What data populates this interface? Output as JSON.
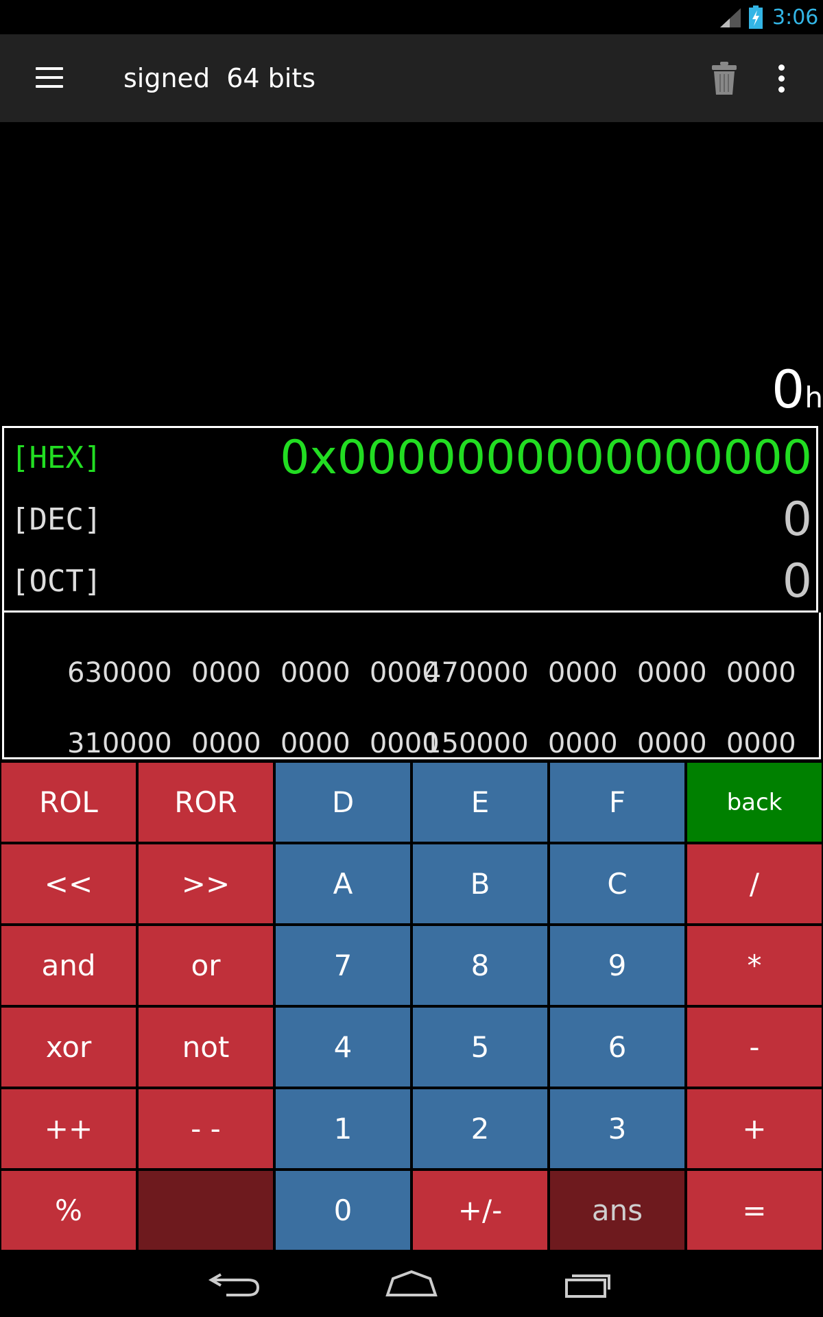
{
  "status_bar": {
    "time": "3:06",
    "icons": [
      "signal-icon",
      "battery-charging-icon"
    ]
  },
  "action_bar": {
    "title": "signed  64 bits",
    "icons": [
      "menu-icon",
      "trash-icon",
      "overflow-menu-icon"
    ]
  },
  "display": {
    "result": "0",
    "result_suffix": "h",
    "bases": [
      {
        "label": "[HEX]",
        "value": "0x0000000000000000",
        "active": true
      },
      {
        "label": "[DEC]",
        "value": "0",
        "active": false
      },
      {
        "label": "[OCT]",
        "value": "0",
        "active": false
      }
    ],
    "bits": [
      {
        "groups": [
          "0000",
          "0000",
          "0000",
          "0000",
          "0000",
          "0000",
          "0000",
          "0000"
        ],
        "index_left": "63",
        "index_mid": "47"
      },
      {
        "groups": [
          "0000",
          "0000",
          "0000",
          "0000",
          "0000",
          "0000",
          "0000",
          "0000"
        ],
        "index_left": "31",
        "index_mid": "15"
      }
    ]
  },
  "keypad": {
    "rows": [
      [
        "ROL",
        "ROR",
        "D",
        "E",
        "F",
        "back"
      ],
      [
        "<<",
        ">>",
        "A",
        "B",
        "C",
        "/"
      ],
      [
        "and",
        "or",
        "7",
        "8",
        "9",
        "*"
      ],
      [
        "xor",
        "not",
        "4",
        "5",
        "6",
        "-"
      ],
      [
        "++",
        "- -",
        "1",
        "2",
        "3",
        "+"
      ],
      [
        "%",
        "",
        "0",
        "+/-",
        "ans",
        "="
      ]
    ]
  },
  "colors": {
    "operator_key": "#c0303a",
    "digit_key": "#3b6fa0",
    "back_key": "#008000",
    "disabled_key": "#6e1a1e",
    "active_base": "#22dd22",
    "time": "#33b5e5"
  },
  "nav_bar": {
    "icons": [
      "back-icon",
      "home-icon",
      "recents-icon"
    ]
  }
}
